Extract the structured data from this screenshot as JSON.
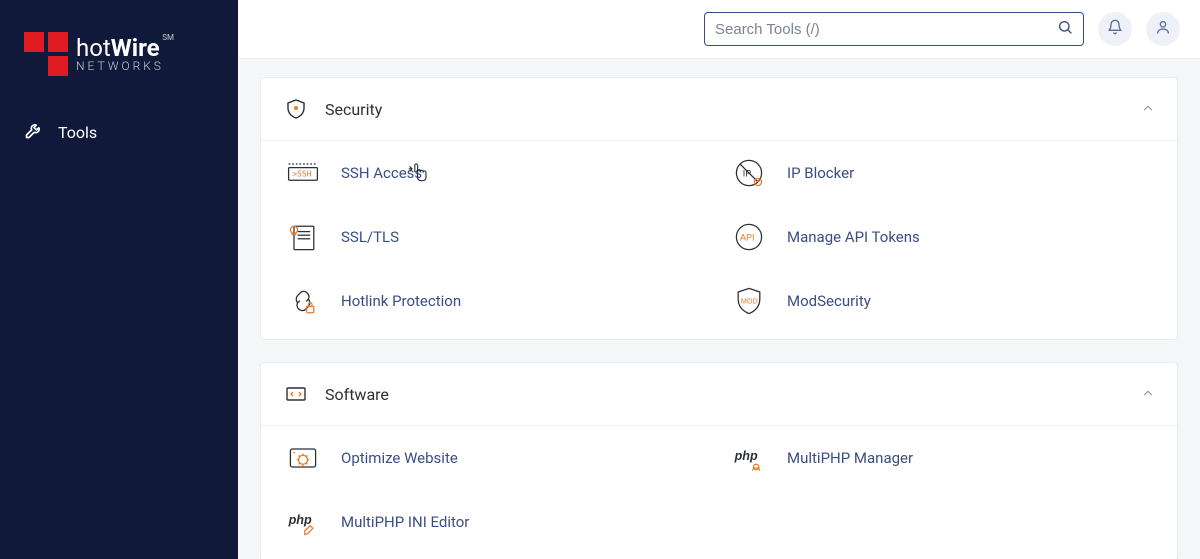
{
  "brand": {
    "name_first": "hot",
    "name_second": "Wire",
    "sub": "NETWORKS",
    "sm": "SM"
  },
  "nav": {
    "tools": "Tools"
  },
  "search": {
    "placeholder": "Search Tools (/)"
  },
  "panels": {
    "security": {
      "title": "Security",
      "items": {
        "ssh": "SSH Access",
        "ipblocker": "IP Blocker",
        "ssltls": "SSL/TLS",
        "apitokens": "Manage API Tokens",
        "hotlink": "Hotlink Protection",
        "modsec": "ModSecurity"
      }
    },
    "software": {
      "title": "Software",
      "items": {
        "optimize": "Optimize Website",
        "multiphp_mgr": "MultiPHP Manager",
        "multiphp_ini": "MultiPHP INI Editor"
      }
    }
  },
  "colors": {
    "accent": "#e87a2a",
    "link": "#3b4d85",
    "sidebar": "#10193a",
    "brand_red": "#e11b22"
  }
}
